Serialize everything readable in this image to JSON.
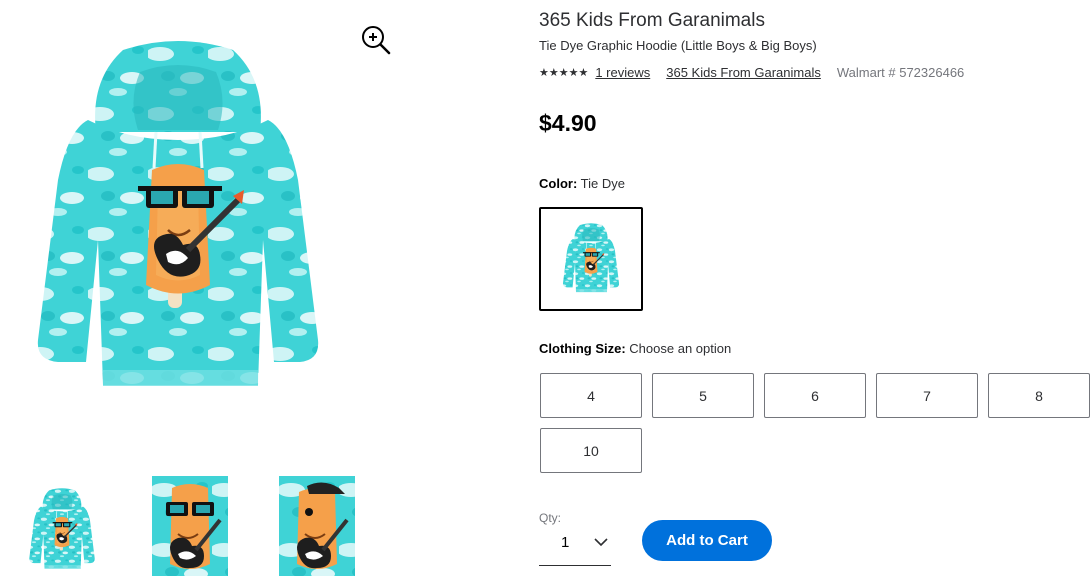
{
  "product": {
    "brand_title": "365 Kids From Garanimals",
    "subtitle": "Tie Dye Graphic Hoodie (Little Boys & Big Boys)",
    "stars_display": "★★★★★",
    "rating": 5,
    "reviews_link": "1 reviews",
    "brand_link": "365 Kids From Garanimals",
    "walmart_number": "Walmart # 572326466",
    "price": "$4.90"
  },
  "color": {
    "label": "Color:",
    "value": "Tie Dye"
  },
  "size": {
    "label": "Clothing Size:",
    "value": "Choose an option",
    "options": [
      "4",
      "5",
      "6",
      "7",
      "8",
      "10"
    ]
  },
  "quantity": {
    "label": "Qty:",
    "value": "1"
  },
  "cart": {
    "button_label": "Add to Cart"
  },
  "icons": {
    "zoom": "zoom-in-icon",
    "chevron": "chevron-down-icon"
  },
  "colors": {
    "accent": "#0071dc",
    "tiedye": "#3fd0d4",
    "popsicle": "#f5a04a"
  }
}
